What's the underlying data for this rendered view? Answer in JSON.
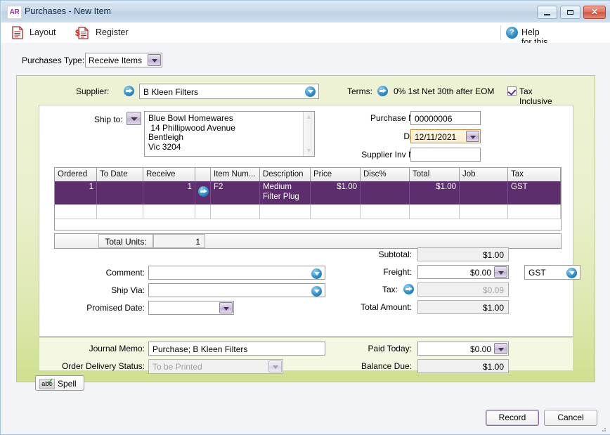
{
  "window": {
    "app_icon_text": "AR",
    "title": "Purchases - New Item",
    "minimize_label": "Minimize",
    "maximize_label": "Maximize",
    "close_label": "✕"
  },
  "toolbar": {
    "layout_label": "Layout",
    "register_label": "Register",
    "register_icon_symbol": "$",
    "help_icon_text": "?",
    "help_label": "Help for this window"
  },
  "purchases_type": {
    "label": "Purchases Type:",
    "value": "Receive Items"
  },
  "header": {
    "supplier_label": "Supplier:",
    "supplier_value": "B Kleen Filters",
    "terms_label": "Terms:",
    "terms_value": "0% 1st Net 30th after EOM",
    "tax_inclusive_label": "Tax Inclusive",
    "tax_inclusive_checked": true,
    "ship_to_label": "Ship to:",
    "ship_to_value": "Blue Bowl Homewares\n 14 Phillipwood Avenue\nBentleigh\nVic 3204",
    "purchase_no_label": "Purchase No.:",
    "purchase_no_value": "00000006",
    "date_label": "Date:",
    "date_value": "12/11/2021",
    "supplier_inv_label": "Supplier Inv No.:",
    "supplier_inv_value": ""
  },
  "grid": {
    "columns": [
      "Ordered",
      "To Date",
      "Receive",
      "",
      "Item Num...",
      "Description",
      "Price",
      "Disc%",
      "Total",
      "Job",
      "Tax",
      ""
    ],
    "rows": [
      {
        "ordered": "1",
        "to_date": "",
        "receive": "1",
        "item_number": "F2",
        "description": "Medium Filter Plug",
        "price": "$1.00",
        "disc": "",
        "total": "$1.00",
        "job": "",
        "tax": "GST",
        "selected": true
      }
    ],
    "total_units_label": "Total Units:",
    "total_units_value": "1"
  },
  "lower_left": {
    "comment_label": "Comment:",
    "comment_value": "",
    "ship_via_label": "Ship Via:",
    "ship_via_value": "",
    "promised_date_label": "Promised Date:",
    "promised_date_value": ""
  },
  "totals": {
    "subtotal_label": "Subtotal:",
    "subtotal_value": "$1.00",
    "freight_label": "Freight:",
    "freight_value": "$0.00",
    "tax_label": "Tax:",
    "tax_value": "$0.09",
    "total_amount_label": "Total Amount:",
    "total_amount_value": "$1.00",
    "tax_code_value": "GST"
  },
  "footer": {
    "journal_memo_label": "Journal Memo:",
    "journal_memo_value": "Purchase; B Kleen Filters",
    "order_delivery_status_label": "Order Delivery Status:",
    "order_delivery_status_value": "To be Printed",
    "paid_today_label": "Paid Today:",
    "paid_today_value": "$0.00",
    "balance_due_label": "Balance Due:",
    "balance_due_value": "$1.00"
  },
  "buttons": {
    "spell_label": "Spell",
    "spell_icon_text": "abc",
    "record_label": "Record",
    "cancel_label": "Cancel"
  },
  "colors": {
    "selected_row": "#5c2e6e",
    "panel_green_top": "#eef2d5",
    "panel_green_bottom": "#cfe08f",
    "accent_blue": "#2e90cf",
    "focus_orange": "#c88d2e"
  }
}
